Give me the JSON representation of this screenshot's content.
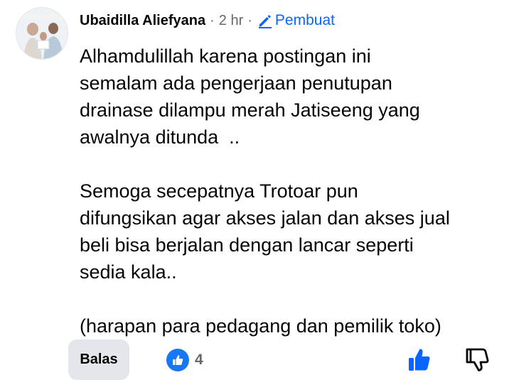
{
  "comment": {
    "author": "Ubaidilla Aliefyana",
    "separator": "·",
    "time": "2 hr",
    "creator_label": "Pembuat",
    "paragraphs": [
      [
        "Alhamdulillah karena postingan ini",
        "semalam ada pengerjaan penutupan",
        "drainase dilampu merah Jatiseeng yang",
        "awalnya ditunda  .."
      ],
      [
        "Semoga secepatnya Trotoar pun",
        "difungsikan agar akses jalan dan akses jual",
        "beli bisa berjalan dengan lancar seperti",
        "sedia kala.."
      ],
      [
        "(harapan para pedagang dan pemilik toko)"
      ]
    ]
  },
  "actions": {
    "reply_label": "Balas",
    "reaction_count": "4",
    "reaction_icon": "thumbs-up-icon",
    "like_icon": "thumbs-up-icon",
    "dislike_icon": "thumbs-down-icon"
  },
  "colors": {
    "accent": "#0866ff",
    "like": "#1877f2",
    "muted": "#65676b",
    "button_bg": "#e4e6eb"
  }
}
